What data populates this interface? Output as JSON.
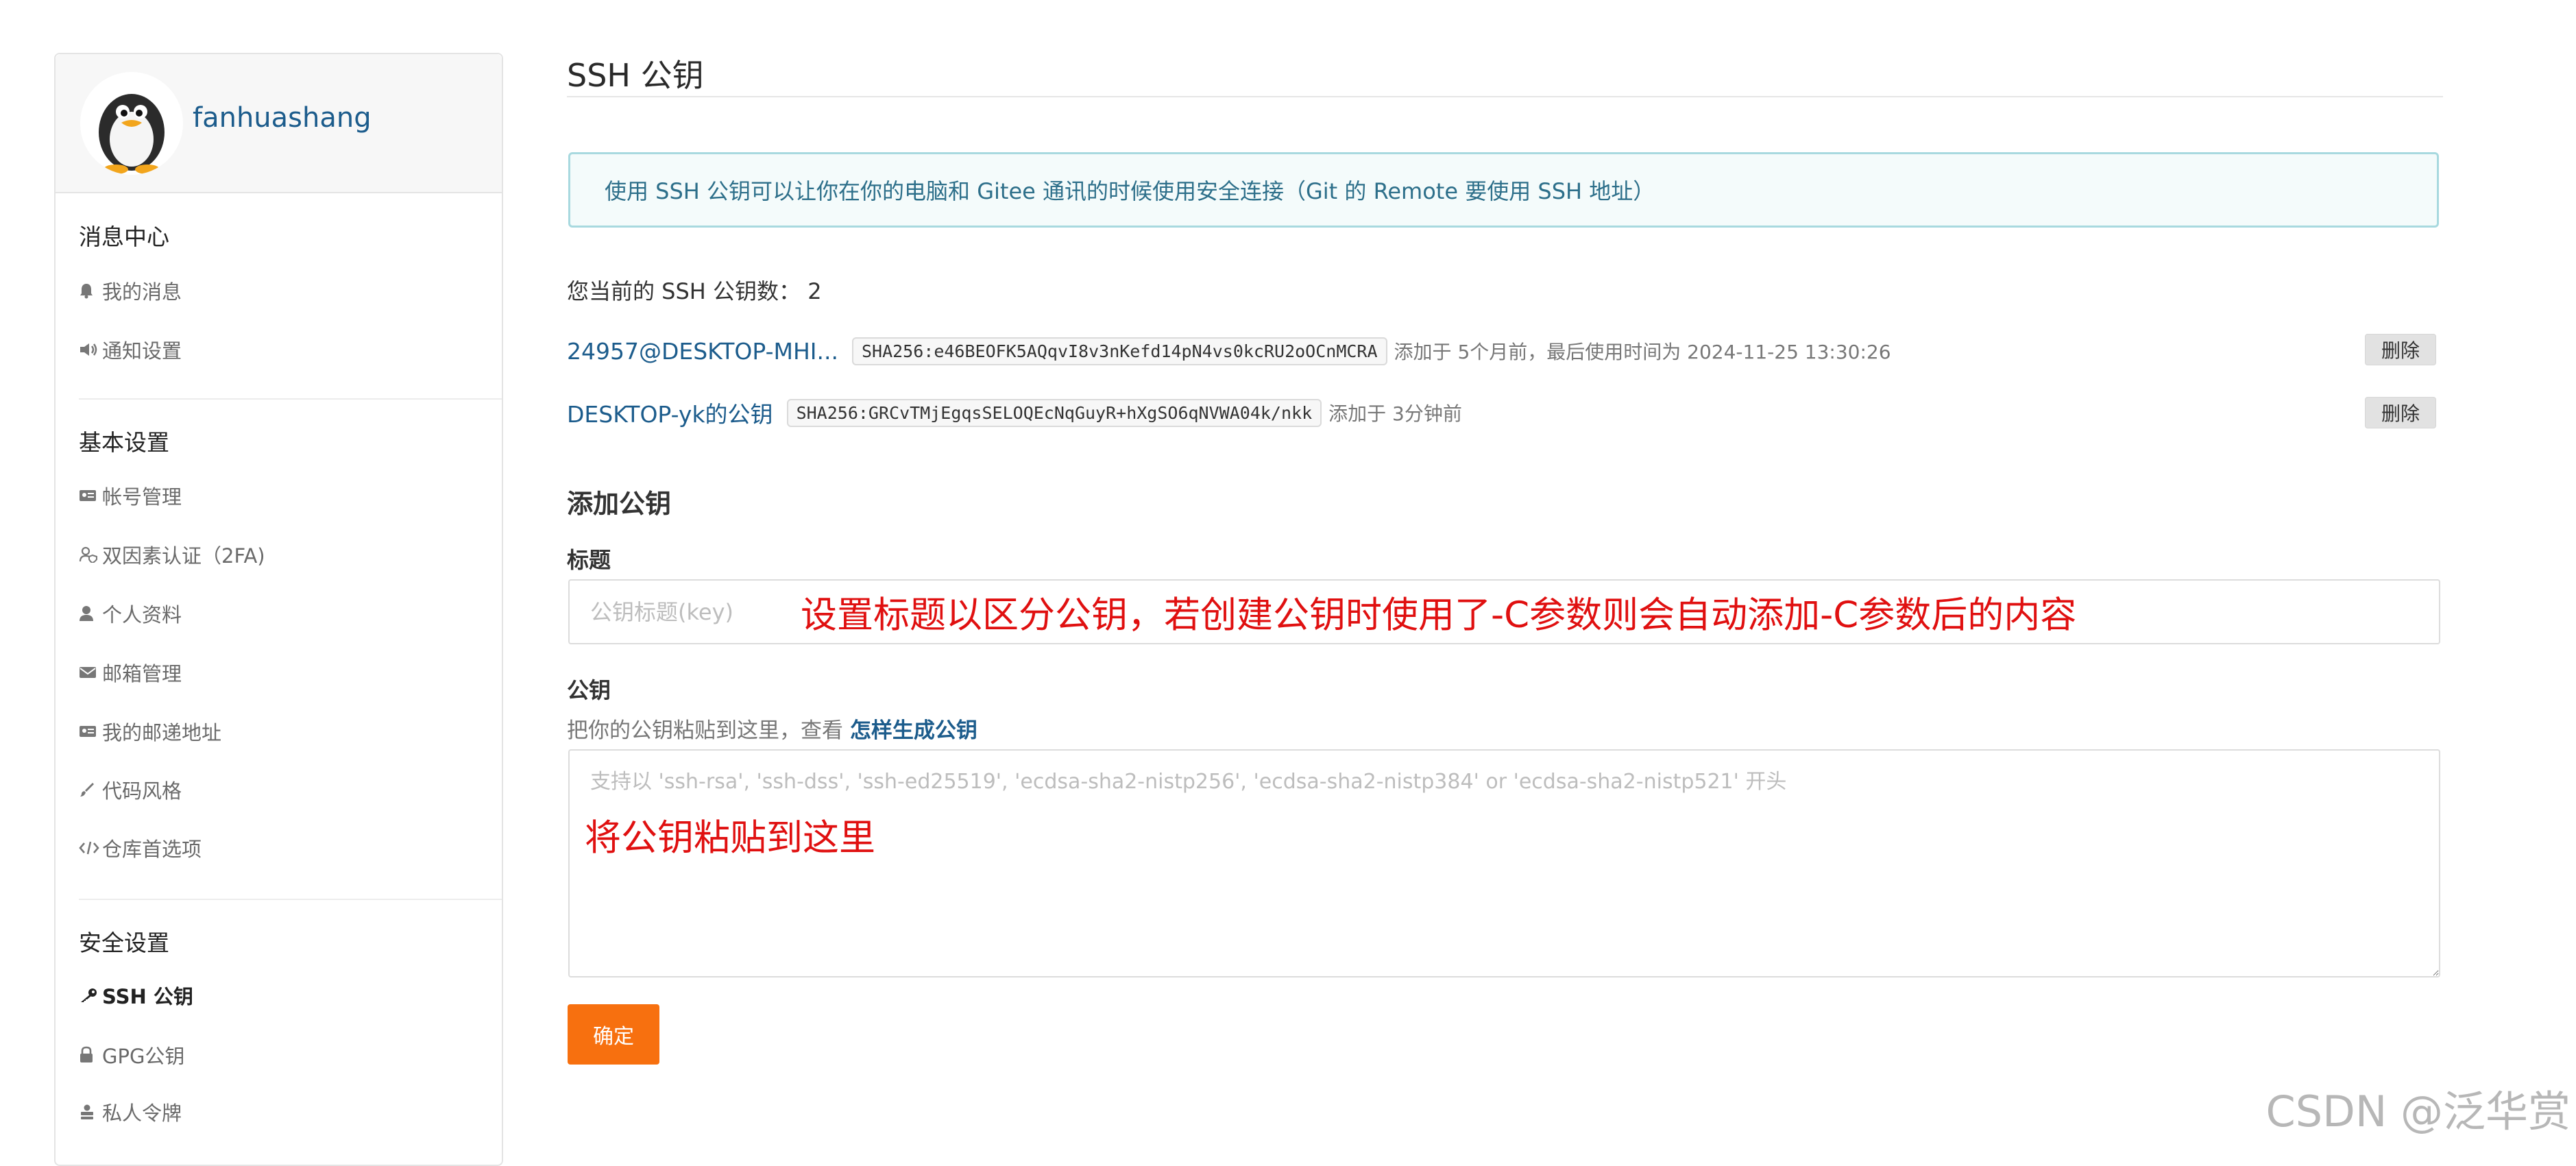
{
  "sidebar": {
    "username": "fanhuashang",
    "groups": [
      {
        "title": "消息中心",
        "items": [
          {
            "icon": "bell-icon",
            "label": "我的消息"
          },
          {
            "icon": "speaker-icon",
            "label": "通知设置"
          }
        ]
      },
      {
        "title": "基本设置",
        "items": [
          {
            "icon": "id-card-icon",
            "label": "帐号管理"
          },
          {
            "icon": "user-shield-icon",
            "label": "双因素认证（2FA)"
          },
          {
            "icon": "user-icon",
            "label": "个人资料"
          },
          {
            "icon": "envelope-icon",
            "label": "邮箱管理"
          },
          {
            "icon": "id-card-icon",
            "label": "我的邮递地址"
          },
          {
            "icon": "brush-icon",
            "label": "代码风格"
          },
          {
            "icon": "code-icon",
            "label": "仓库首选项"
          }
        ]
      },
      {
        "title": "安全设置",
        "items": [
          {
            "icon": "key-icon",
            "label": "SSH 公钥",
            "active": true
          },
          {
            "icon": "lock-icon",
            "label": "GPG公钥"
          },
          {
            "icon": "token-icon",
            "label": "私人令牌"
          }
        ]
      }
    ]
  },
  "main": {
    "title": "SSH 公钥",
    "info": "使用 SSH 公钥可以让你在你的电脑和 Gitee 通讯的时候使用安全连接（Git 的 Remote 要使用 SSH 地址）",
    "count_label": "您当前的 SSH 公钥数：",
    "count_value": "2",
    "keys": [
      {
        "name": "24957@DESKTOP-MHI...",
        "fingerprint": "SHA256:e46BEOFK5AQqvI8v3nKefd14pN4vs0kcRU2oOCnMCRA",
        "added": "添加于 5个月前，最后使用时间为 2024-11-25 13:30:26",
        "delete": "删除"
      },
      {
        "name": "DESKTOP-yk的公钥",
        "fingerprint": "SHA256:GRCvTMjEgqsSELOQEcNqGuyR+hXgSO6qNVWA04k/nkk",
        "added": "添加于 3分钟前",
        "delete": "删除"
      }
    ],
    "add_heading": "添加公钥",
    "title_label": "标题",
    "title_placeholder": "公钥标题(key)",
    "title_annotation": "设置标题以区分公钥，若创建公钥时使用了-C参数则会自动添加-C参数后的内容",
    "key_label": "公钥",
    "key_hint_prefix": "把你的公钥粘贴到这里，查看",
    "key_hint_link": "怎样生成公钥",
    "key_placeholder": "支持以 'ssh-rsa', 'ssh-dss', 'ssh-ed25519', 'ecdsa-sha2-nistp256', 'ecdsa-sha2-nistp384' or 'ecdsa-sha2-nistp521' 开头",
    "key_annotation": "将公钥粘贴到这里",
    "confirm": "确定"
  },
  "watermark": "CSDN @泛华赏"
}
